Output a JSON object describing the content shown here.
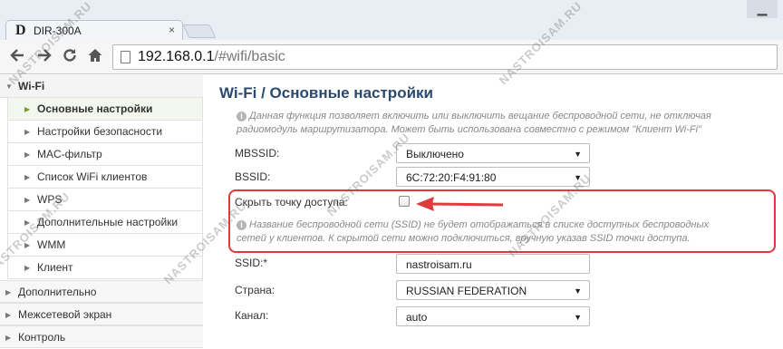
{
  "browser": {
    "tab_title": "DIR-300A",
    "favicon": "D",
    "close_glyph": "×",
    "window_button": "▁",
    "url_host": "192.168.0.1",
    "url_path": "/#wifi/basic"
  },
  "icons": [
    "back-icon",
    "forward-icon",
    "reload-icon",
    "home-icon",
    "page-icon",
    "info-icon"
  ],
  "sidebar": {
    "section": "Wi-Fi",
    "items": [
      {
        "label": "Основные настройки",
        "active": true
      },
      {
        "label": "Настройки безопасности"
      },
      {
        "label": "MAC-фильтр"
      },
      {
        "label": "Список WiFi клиентов"
      },
      {
        "label": "WPS"
      },
      {
        "label": "Дополнительные настройки"
      },
      {
        "label": "WMM"
      },
      {
        "label": "Клиент"
      }
    ],
    "top_items": [
      "Дополнительно",
      "Межсетевой экран",
      "Контроль"
    ]
  },
  "main": {
    "title": "Wi-Fi /  Основные настройки",
    "info1_line1": "Данная функция позволяет включить или выключить вещание беспроводной сети, не отключая",
    "info1_line2": "радиомодуль маршрутизатора. Может быть использована совместно с режимом \"Клиент Wi-Fi\"",
    "mbssid_label": "MBSSID:",
    "mbssid_value": "Выключено",
    "bssid_label": "BSSID:",
    "bssid_value": "6C:72:20:F4:91:80",
    "hide_label": "Скрыть точку доступа:",
    "hide_checked": false,
    "info2_line1": "Название беспроводной сети (SSID) не будет отображаться в списке доступных беспроводных",
    "info2_line2": "сетей у клиентов. К скрытой сети можно подключиться, вручную указав SSID точки доступа.",
    "ssid_label": "SSID:*",
    "ssid_value": "nastroisam.ru",
    "country_label": "Страна:",
    "country_value": "RUSSIAN FEDERATION",
    "channel_label": "Канал:",
    "channel_value": "auto"
  },
  "watermark": "NASTROISAM.RU",
  "colors": {
    "accent_title": "#2b4a6f",
    "highlight": "#e03a3a",
    "active_arrow": "#7a9d2f"
  }
}
